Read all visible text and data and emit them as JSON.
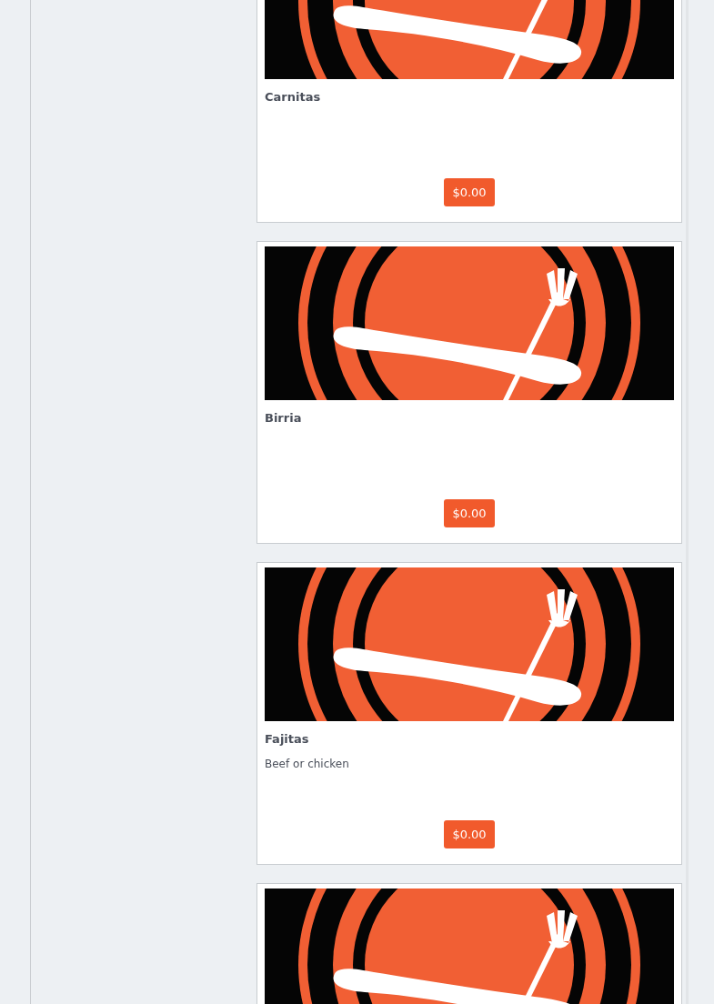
{
  "menu_items": [
    {
      "image": {
        "kind": "picture"
      },
      "name": "Carnitas",
      "price": "$0.00"
    },
    {
      "image": {
        "kind": "picture"
      },
      "name": "Birria",
      "price": "$0.00"
    },
    {
      "image": {
        "kind": "picture"
      },
      "name": "Fajitas",
      "description": "Beef or chicken",
      "price": "$0.00"
    },
    {
      "image": {
        "kind": "picture"
      }
    }
  ]
}
